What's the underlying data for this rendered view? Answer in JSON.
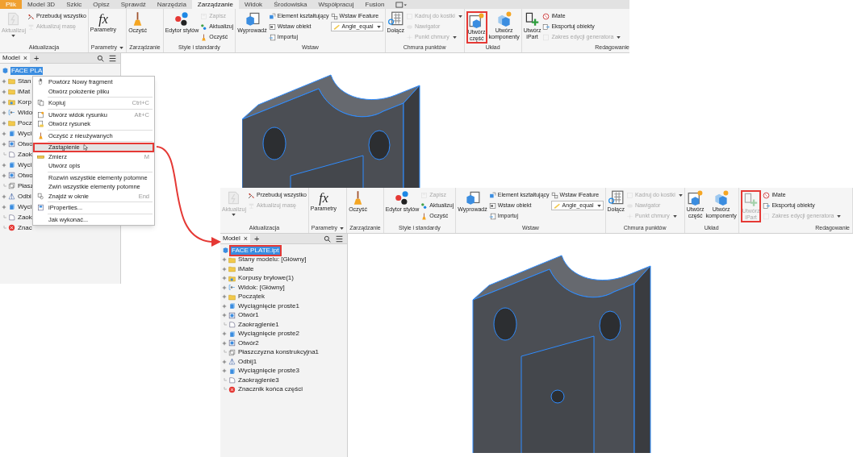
{
  "window_a": {
    "ribbon_tabs": [
      {
        "label": "Plik",
        "kind": "file",
        "selected": false
      },
      {
        "label": "Model 3D",
        "kind": "tab",
        "selected": false
      },
      {
        "label": "Szkic",
        "kind": "tab",
        "selected": false
      },
      {
        "label": "Opisz",
        "kind": "tab",
        "selected": false
      },
      {
        "label": "Sprawdź",
        "kind": "tab",
        "selected": false
      },
      {
        "label": "Narzędzia",
        "kind": "tab",
        "selected": false
      },
      {
        "label": "Zarządzanie",
        "kind": "tab",
        "selected": true
      },
      {
        "label": "Widok",
        "kind": "tab",
        "selected": false
      },
      {
        "label": "Środowiska",
        "kind": "tab",
        "selected": false
      },
      {
        "label": "Współpracuj",
        "kind": "tab",
        "selected": false
      },
      {
        "label": "Fusion",
        "kind": "tab",
        "selected": false
      }
    ],
    "ribbon": {
      "panels": [
        {
          "title": "Aktualizacja",
          "title_dropdown": false,
          "columns": [
            [
              {
                "kind": "large",
                "label": "Aktualizuj",
                "disabled": true,
                "dropdown": true,
                "highlighted": false
              }
            ],
            [
              {
                "kind": "small",
                "label": "Przebuduj wszystko",
                "disabled": false,
                "dropdown": false
              },
              {
                "kind": "small",
                "label": "Aktualizuj masę",
                "disabled": true,
                "dropdown": false
              }
            ]
          ]
        },
        {
          "title": "Parametry",
          "title_dropdown": true,
          "columns": [
            [
              {
                "kind": "large",
                "label": "Parametry",
                "icon_text": "fx",
                "disabled": false,
                "dropdown": false,
                "highlighted": false
              }
            ]
          ]
        },
        {
          "title": "Zarządzanie",
          "title_dropdown": false,
          "columns": [
            [
              {
                "kind": "large",
                "label": "Oczyść",
                "disabled": false,
                "dropdown": false,
                "highlighted": false
              }
            ]
          ]
        },
        {
          "title": "Style i standardy",
          "title_dropdown": false,
          "columns": [
            [
              {
                "kind": "large",
                "label": "Edytor stylów",
                "disabled": false,
                "dropdown": false,
                "highlighted": false
              }
            ],
            [
              {
                "kind": "small",
                "label": "Zapisz",
                "disabled": true,
                "dropdown": false
              },
              {
                "kind": "small",
                "label": "Aktualizuj",
                "disabled": false,
                "dropdown": false
              },
              {
                "kind": "small",
                "label": "Oczyść",
                "disabled": false,
                "dropdown": false
              }
            ]
          ]
        },
        {
          "title": "Wstaw",
          "title_dropdown": false,
          "columns": [
            [
              {
                "kind": "large",
                "label": "Wyprowadź",
                "disabled": false,
                "dropdown": false,
                "highlighted": false
              }
            ],
            [
              {
                "kind": "small",
                "label": "Element kształtujący",
                "disabled": false,
                "dropdown": false
              },
              {
                "kind": "small",
                "label": "Wstaw obiekt",
                "disabled": false,
                "dropdown": false
              },
              {
                "kind": "small",
                "label": "Importuj",
                "disabled": false,
                "dropdown": false
              }
            ],
            [
              {
                "kind": "small",
                "label": "Wstaw iFeature",
                "disabled": false,
                "dropdown": false
              },
              {
                "kind": "combo",
                "label": "Angle_equal",
                "disabled": false,
                "dropdown": true
              }
            ]
          ]
        },
        {
          "title": "Chmura punktów",
          "title_dropdown": false,
          "columns": [
            [
              {
                "kind": "large",
                "label": "Dołącz",
                "disabled": false,
                "dropdown": false,
                "highlighted": false
              }
            ],
            [
              {
                "kind": "small",
                "label": "Kadruj do kostki",
                "disabled": true,
                "dropdown": true
              },
              {
                "kind": "small",
                "label": "Nawigator",
                "disabled": true,
                "dropdown": false
              },
              {
                "kind": "small",
                "label": "Punkt chmury",
                "disabled": true,
                "dropdown": true
              }
            ]
          ]
        },
        {
          "title": "Układ",
          "title_dropdown": false,
          "columns": [
            [
              {
                "kind": "large",
                "label": "Utwórz\nczęść",
                "disabled": false,
                "dropdown": false,
                "highlighted": true
              }
            ],
            [
              {
                "kind": "large",
                "label": "Utwórz\nkomponenty",
                "disabled": false,
                "dropdown": false,
                "highlighted": false
              }
            ]
          ]
        },
        {
          "title": "Redagowanie",
          "title_dropdown": false,
          "columns": [
            [
              {
                "kind": "large",
                "label": "Utwórz\niPart",
                "disabled": false,
                "dropdown": false,
                "highlighted": false
              }
            ],
            [
              {
                "kind": "small",
                "label": "iMate",
                "disabled": false,
                "dropdown": false
              },
              {
                "kind": "small",
                "label": "Eksportuj obiekty",
                "disabled": false,
                "dropdown": false
              },
              {
                "kind": "small",
                "label": "Zakres edycji generatora",
                "disabled": true,
                "dropdown": true
              }
            ]
          ]
        }
      ]
    },
    "browser": {
      "tab": "Model",
      "close": "×",
      "add": "+",
      "tree": [
        {
          "label": "FACE PLA",
          "selected": true,
          "highlighted": false,
          "children": [
            {
              "label": "Stan",
              "expandable": true
            },
            {
              "label": "iMat",
              "expandable": true
            },
            {
              "label": "Korp",
              "expandable": true
            },
            {
              "label": "Wido",
              "expandable": true
            },
            {
              "label": "Pocz",
              "expandable": true
            },
            {
              "label": "Wyci",
              "expandable": true
            },
            {
              "label": "Otwo",
              "expandable": true
            },
            {
              "label": "Zaok",
              "expandable": false
            },
            {
              "label": "Wyci",
              "expandable": true
            },
            {
              "label": "Otwo",
              "expandable": true
            },
            {
              "label": "Płasz",
              "expandable": false
            },
            {
              "label": "Odbi",
              "expandable": true
            },
            {
              "label": "Wyci",
              "expandable": true
            },
            {
              "label": "Zaok",
              "expandable": false
            },
            {
              "label": "Znac",
              "expandable": false
            }
          ]
        }
      ]
    },
    "context_menu": [
      {
        "kind": "item",
        "label": "Powtórz Nowy fragment",
        "selected": false,
        "highlighted": false,
        "pointer": false
      },
      {
        "kind": "item",
        "label": "Otwórz położenie pliku",
        "selected": false,
        "highlighted": false,
        "pointer": false
      },
      {
        "kind": "separator"
      },
      {
        "kind": "item",
        "label": "Kopiuj",
        "shortcut": "Ctrl+C",
        "selected": false,
        "highlighted": false,
        "pointer": false
      },
      {
        "kind": "separator"
      },
      {
        "kind": "item",
        "label": "Utwórz widok rysunku",
        "shortcut": "Alt+C",
        "selected": false,
        "highlighted": false,
        "pointer": false
      },
      {
        "kind": "item",
        "label": "Otwórz rysunek",
        "selected": false,
        "highlighted": false,
        "pointer": false
      },
      {
        "kind": "separator"
      },
      {
        "kind": "item",
        "label": "Oczyść z nieużywanych",
        "selected": false,
        "highlighted": false,
        "pointer": false
      },
      {
        "kind": "separator"
      },
      {
        "kind": "item",
        "label": "Zastąpienie",
        "selected": true,
        "highlighted": true,
        "pointer": true
      },
      {
        "kind": "item",
        "label": "Zmierz",
        "shortcut": "M",
        "selected": false,
        "highlighted": false,
        "pointer": false
      },
      {
        "kind": "item",
        "label": "Utwórz opis",
        "selected": false,
        "highlighted": false,
        "pointer": false
      },
      {
        "kind": "separator"
      },
      {
        "kind": "item",
        "label": "Rozwiń wszystkie elementy potomne",
        "selected": false,
        "highlighted": false,
        "pointer": false
      },
      {
        "kind": "item",
        "label": "Zwiń wszystkie elementy potomne",
        "selected": false,
        "highlighted": false,
        "pointer": false
      },
      {
        "kind": "item",
        "label": "Znajdź w oknie",
        "shortcut": "End",
        "selected": false,
        "highlighted": false,
        "pointer": false
      },
      {
        "kind": "separator"
      },
      {
        "kind": "item",
        "label": "iProperties...",
        "selected": false,
        "highlighted": false,
        "pointer": false
      },
      {
        "kind": "separator"
      },
      {
        "kind": "item",
        "label": "Jak wykonać...",
        "selected": false,
        "highlighted": false,
        "pointer": false
      }
    ]
  },
  "window_b": {
    "ribbon": {
      "panels": [
        {
          "title": "Aktualizacja",
          "title_dropdown": false,
          "columns": [
            [
              {
                "kind": "large",
                "label": "Aktualizuj",
                "disabled": true,
                "dropdown": true,
                "highlighted": false
              }
            ],
            [
              {
                "kind": "small",
                "label": "Przebuduj wszystko",
                "disabled": false,
                "dropdown": false
              },
              {
                "kind": "small",
                "label": "Aktualizuj masę",
                "disabled": true,
                "dropdown": false
              }
            ]
          ]
        },
        {
          "title": "Parametry",
          "title_dropdown": true,
          "columns": [
            [
              {
                "kind": "large",
                "label": "Parametry",
                "icon_text": "fx",
                "disabled": false,
                "dropdown": false,
                "highlighted": false
              }
            ]
          ]
        },
        {
          "title": "Zarządzanie",
          "title_dropdown": false,
          "columns": [
            [
              {
                "kind": "large",
                "label": "Oczyść",
                "disabled": false,
                "dropdown": false,
                "highlighted": false
              }
            ]
          ]
        },
        {
          "title": "Style i standardy",
          "title_dropdown": false,
          "columns": [
            [
              {
                "kind": "large",
                "label": "Edytor stylów",
                "disabled": false,
                "dropdown": false,
                "highlighted": false
              }
            ],
            [
              {
                "kind": "small",
                "label": "Zapisz",
                "disabled": true,
                "dropdown": false
              },
              {
                "kind": "small",
                "label": "Aktualizuj",
                "disabled": false,
                "dropdown": false
              },
              {
                "kind": "small",
                "label": "Oczyść",
                "disabled": false,
                "dropdown": false
              }
            ]
          ]
        },
        {
          "title": "Wstaw",
          "title_dropdown": false,
          "columns": [
            [
              {
                "kind": "large",
                "label": "Wyprowadź",
                "disabled": false,
                "dropdown": false,
                "highlighted": false
              }
            ],
            [
              {
                "kind": "small",
                "label": "Element kształtujący",
                "disabled": false,
                "dropdown": false
              },
              {
                "kind": "small",
                "label": "Wstaw obiekt",
                "disabled": false,
                "dropdown": false
              },
              {
                "kind": "small",
                "label": "Importuj",
                "disabled": false,
                "dropdown": false
              }
            ],
            [
              {
                "kind": "small",
                "label": "Wstaw iFeature",
                "disabled": false,
                "dropdown": false
              },
              {
                "kind": "combo",
                "label": "Angle_equal",
                "disabled": false,
                "dropdown": true
              }
            ]
          ]
        },
        {
          "title": "Chmura punktów",
          "title_dropdown": false,
          "columns": [
            [
              {
                "kind": "large",
                "label": "Dołącz",
                "disabled": false,
                "dropdown": false,
                "highlighted": false
              }
            ],
            [
              {
                "kind": "small",
                "label": "Kadruj do kostki",
                "disabled": true,
                "dropdown": true
              },
              {
                "kind": "small",
                "label": "Nawigator",
                "disabled": true,
                "dropdown": false
              },
              {
                "kind": "small",
                "label": "Punkt chmury",
                "disabled": true,
                "dropdown": true
              }
            ]
          ]
        },
        {
          "title": "Układ",
          "title_dropdown": false,
          "columns": [
            [
              {
                "kind": "large",
                "label": "Utwórz\nczęść",
                "disabled": false,
                "dropdown": false,
                "highlighted": false
              }
            ],
            [
              {
                "kind": "large",
                "label": "Utwórz\nkomponenty",
                "disabled": false,
                "dropdown": false,
                "highlighted": false
              }
            ]
          ]
        },
        {
          "title": "Redagowanie",
          "title_dropdown": false,
          "columns": [
            [
              {
                "kind": "large",
                "label": "Utwórz\niPart",
                "disabled": true,
                "dropdown": false,
                "highlighted": true
              }
            ],
            [
              {
                "kind": "small",
                "label": "iMate",
                "disabled": false,
                "dropdown": false
              },
              {
                "kind": "small",
                "label": "Eksportuj obiekty",
                "disabled": false,
                "dropdown": false
              },
              {
                "kind": "small",
                "label": "Zakres edycji generatora",
                "disabled": true,
                "dropdown": true
              }
            ]
          ]
        }
      ]
    },
    "browser": {
      "tab": "Model",
      "close": "×",
      "add": "+",
      "tree": [
        {
          "label": "FACE PLATE.ipt",
          "selected": true,
          "highlighted": true,
          "children": [
            {
              "label": "Stany modelu: [Główny]",
              "expandable": true
            },
            {
              "label": "iMate",
              "expandable": true
            },
            {
              "label": "Korpusy bryłowe(1)",
              "expandable": true
            },
            {
              "label": "Widok: [Główny]",
              "expandable": true
            },
            {
              "label": "Początek",
              "expandable": true
            },
            {
              "label": "Wyciągnięcie proste1",
              "expandable": true
            },
            {
              "label": "Otwór1",
              "expandable": true
            },
            {
              "label": "Zaokrąglenie1",
              "expandable": false
            },
            {
              "label": "Wyciągnięcie proste2",
              "expandable": true
            },
            {
              "label": "Otwór2",
              "expandable": true
            },
            {
              "label": "Płaszczyzna konstrukcyjna1",
              "expandable": false
            },
            {
              "label": "Odbij1",
              "expandable": true
            },
            {
              "label": "Wyciągnięcie proste3",
              "expandable": true
            },
            {
              "label": "Zaokrąglenie3",
              "expandable": false
            },
            {
              "label": "Znacznik końca części",
              "expandable": false
            }
          ]
        }
      ]
    }
  }
}
